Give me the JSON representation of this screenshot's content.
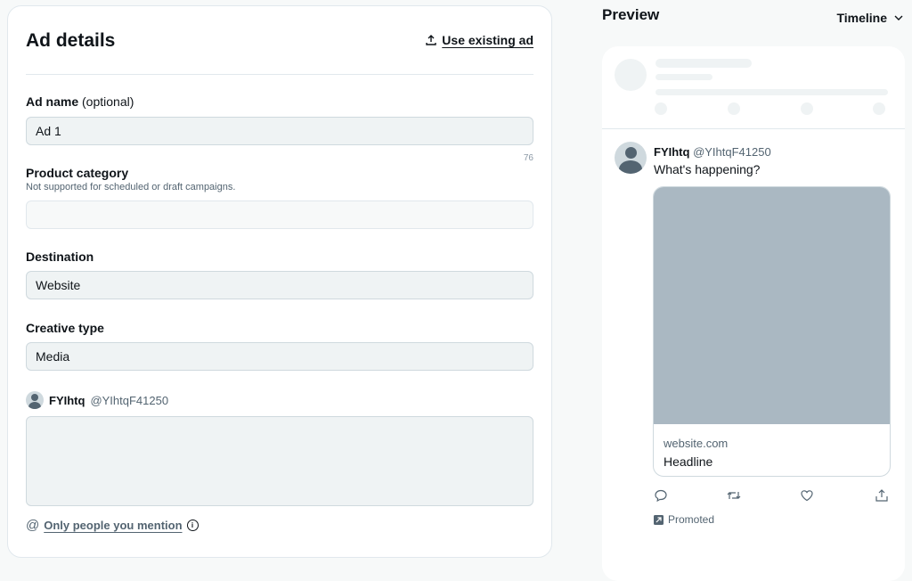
{
  "form": {
    "title": "Ad details",
    "use_existing_label": "Use existing ad",
    "ad_name": {
      "label": "Ad name",
      "optional": "(optional)",
      "value": "Ad 1",
      "counter": "76"
    },
    "product_category": {
      "label": "Product category",
      "hint": "Not supported for scheduled or draft campaigns.",
      "value": ""
    },
    "destination": {
      "label": "Destination",
      "value": "Website"
    },
    "creative_type": {
      "label": "Creative type",
      "value": "Media"
    },
    "author": {
      "name": "FYIhtq",
      "handle": "@YIhtqF41250"
    },
    "tweet_text": "",
    "mention": {
      "at": "@",
      "label": "Only people you mention"
    }
  },
  "preview": {
    "title": "Preview",
    "placement": "Timeline",
    "tweet": {
      "name": "FYIhtq",
      "handle": "@YIhtqF41250",
      "text": "What's happening?",
      "card_domain": "website.com",
      "card_headline": "Headline"
    },
    "promoted_label": "Promoted"
  },
  "colors": {
    "media_placeholder": "#aab8c2",
    "field_bg": "#eff3f4",
    "muted_text": "#536471"
  }
}
